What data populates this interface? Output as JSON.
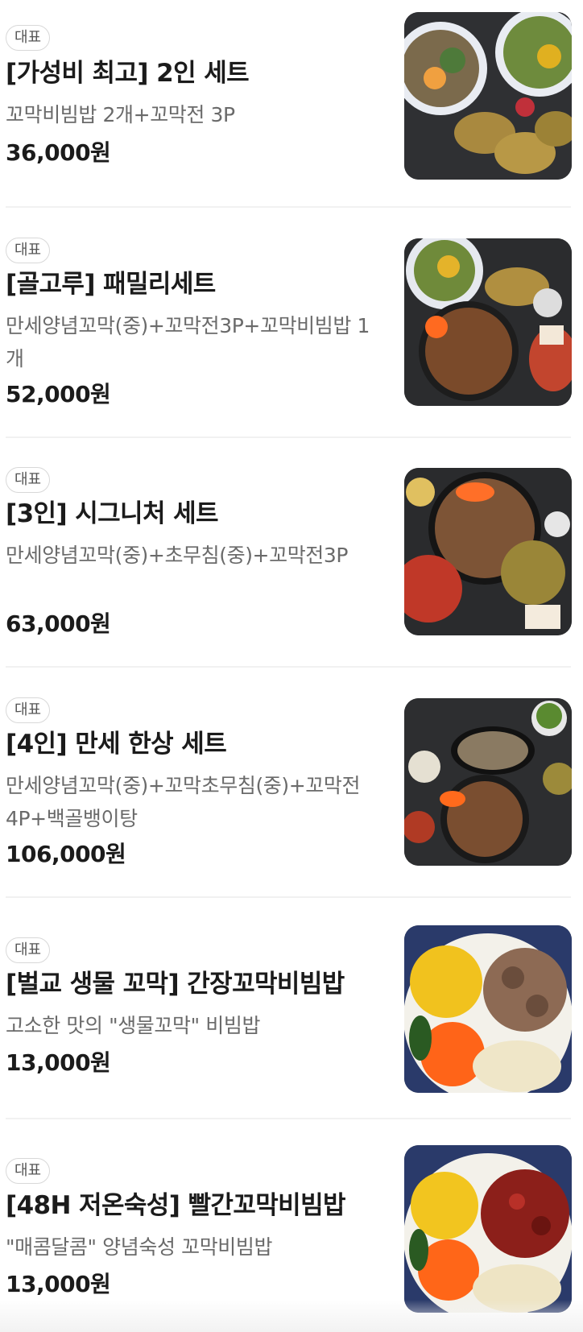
{
  "menu": {
    "items": [
      {
        "badge": "대표",
        "title": "[가성비 최고] 2인 세트",
        "desc": "꼬막비빔밥 2개+꼬막전 3P",
        "price": "36,000원",
        "image": "set-2-photo"
      },
      {
        "badge": "대표",
        "title": "[골고루] 패밀리세트",
        "desc": "만세양념꼬막(중)+꼬막전3P+꼬막비빔밥 1개",
        "price": "52,000원",
        "image": "family-set-photo"
      },
      {
        "badge": "대표",
        "title": "[3인] 시그니처 세트",
        "desc": "만세양념꼬막(중)+초무침(중)+꼬막전3P",
        "price": "63,000원",
        "image": "signature-set-photo"
      },
      {
        "badge": "대표",
        "title": "[4인] 만세 한상 세트",
        "desc": "만세양념꼬막(중)+꼬막초무침(중)+꼬막전4P+백골뱅이탕",
        "price": "106,000원",
        "image": "hansang-set-photo"
      },
      {
        "badge": "대표",
        "title": "[벌교 생물 꼬막] 간장꼬막비빔밥",
        "desc": "고소한 맛의 \"생물꼬막\" 비빔밥",
        "price": "13,000원",
        "image": "soy-bibimbap-photo"
      },
      {
        "badge": "대표",
        "title": "[48H 저온숙성] 빨간꼬막비빔밥",
        "desc": "\"매콤달콤\" 양념숙성 꼬막비빔밥",
        "price": "13,000원",
        "image": "red-bibimbap-photo"
      }
    ]
  }
}
